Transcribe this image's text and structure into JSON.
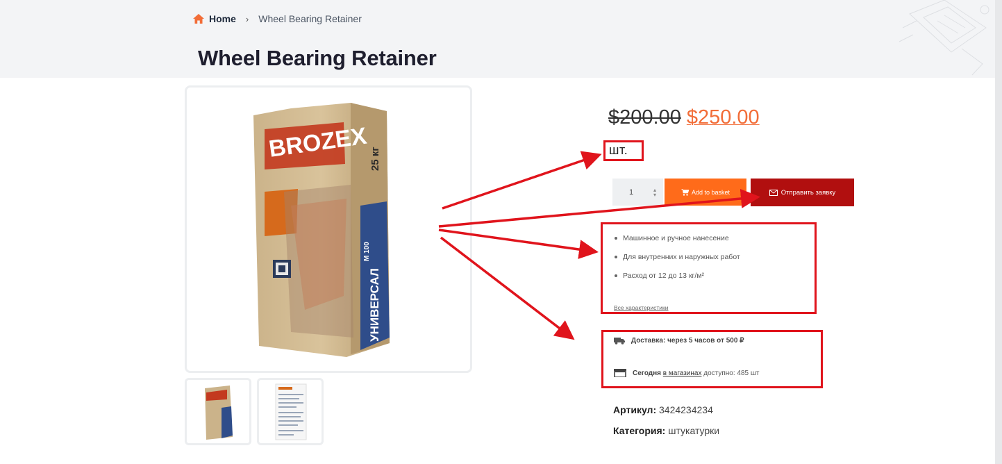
{
  "breadcrumb": {
    "home_label": "Home",
    "separator": "›",
    "current": "Wheel Bearing Retainer"
  },
  "page_title": "Wheel Bearing Retainer",
  "product": {
    "image_alt": "BROZEX Универсал bag 25 кг",
    "brand_text": "BROZEX",
    "bag_weight": "25 кг",
    "bag_product": "УНИВЕРСАЛ",
    "bag_model": "М 100"
  },
  "price": {
    "old": "$200.00",
    "new": "$250.00"
  },
  "unit": "шт.",
  "purchase": {
    "quantity": "1",
    "add_to_basket": "Add to basket",
    "send_request": "Отправить заявку"
  },
  "features": {
    "items": [
      "Машинное и ручное нанесение",
      "Для внутренних и наружных работ",
      "Расход от 12 до 13 кг/м²"
    ],
    "all_link": "Все характеристики"
  },
  "delivery": {
    "shipping_label": "Доставка:",
    "shipping_value": "через 5 часов от 500 ₽",
    "today_label": "Сегодня",
    "stores_link": "в магазинах",
    "available_text": "доступно: 485 шт"
  },
  "meta": {
    "sku_label": "Артикул:",
    "sku_value": "3424234234",
    "category_label": "Категория:",
    "category_value": "штукатурки"
  },
  "colors": {
    "accent_orange": "#ff6b1a",
    "request_red": "#b10f0f",
    "annotation_red": "#e0141c",
    "price_new": "#f26d38"
  }
}
